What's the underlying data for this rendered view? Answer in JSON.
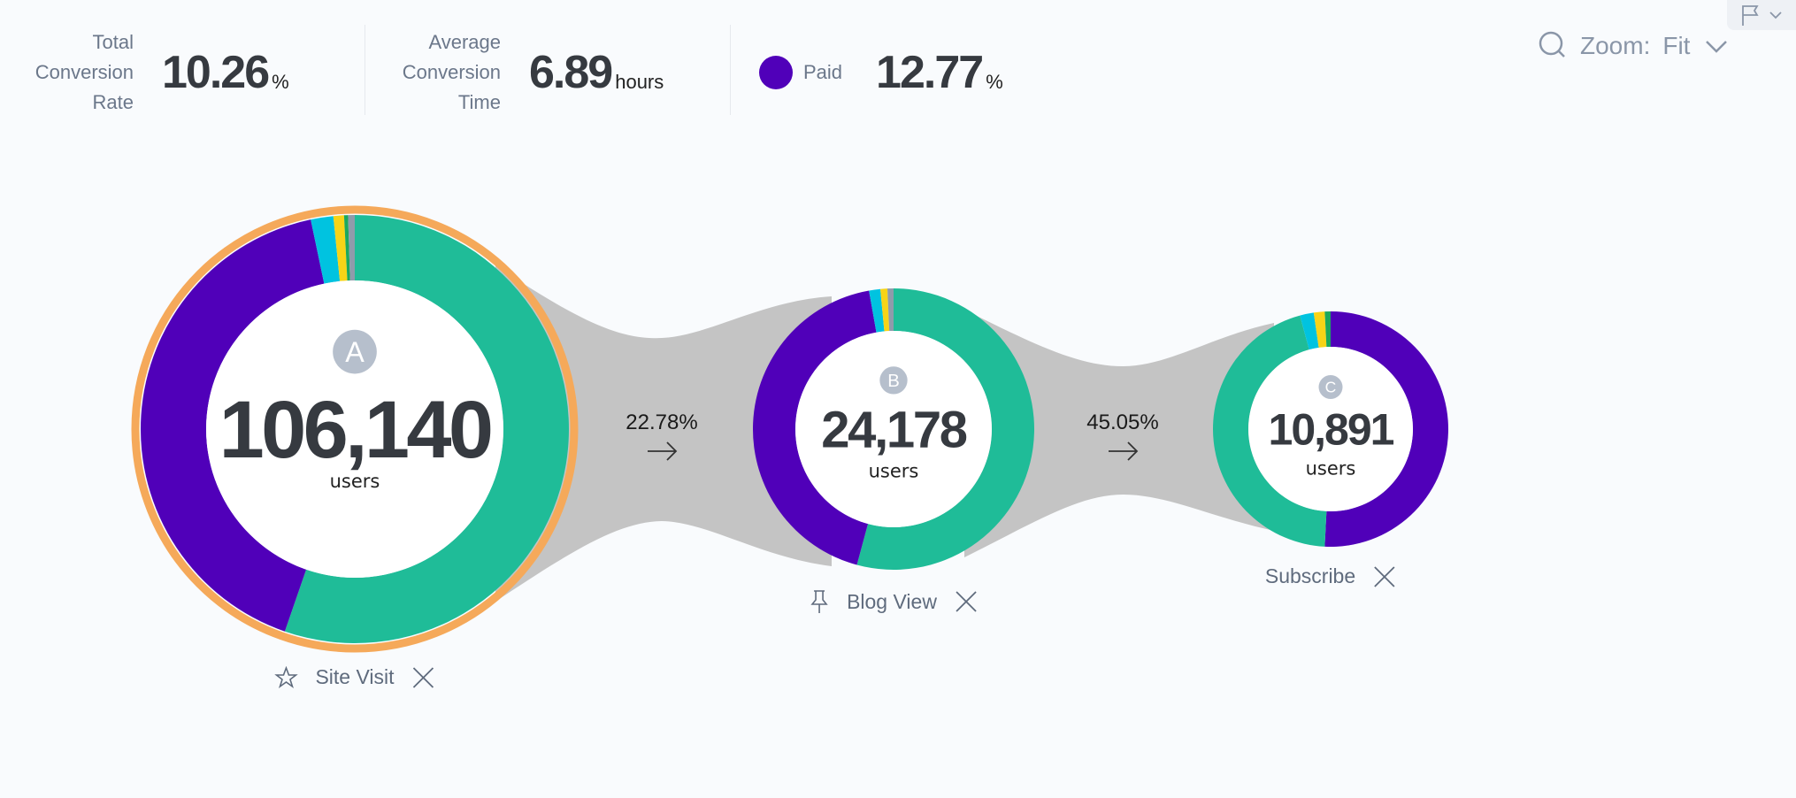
{
  "metrics": {
    "total_conversion": {
      "label_lines": [
        "Total",
        "Conversion",
        "Rate"
      ],
      "value": "10.26",
      "unit": "%"
    },
    "avg_conversion_time": {
      "label_lines": [
        "Average",
        "Conversion",
        "Time"
      ],
      "value": "6.89",
      "unit": "hours"
    },
    "segment": {
      "label": "Paid",
      "value": "12.77",
      "unit": "%",
      "color": "#5000b9"
    }
  },
  "zoom": {
    "label": "Zoom:",
    "value": "Fit",
    "icon": "magnifier-icon"
  },
  "flag_menu": {
    "icon": "flag-icon"
  },
  "colors": {
    "teal": "#1fbc98",
    "purple": "#5000b9",
    "cyan": "#00c3e0",
    "yellow": "#f7d417",
    "green": "#1ba85e",
    "gray": "#8f9bab",
    "selected_ring": "#f5a95a",
    "flow": "#c4c4c4"
  },
  "steps": [
    {
      "letter": "A",
      "count": "106,140",
      "unit": "users",
      "name": "Site Visit",
      "icon": "star-icon",
      "selected": true,
      "segments": [
        {
          "color": "#1fbc98",
          "pct": 55.3
        },
        {
          "color": "#5000b9",
          "pct": 41.4
        },
        {
          "color": "#00c3e0",
          "pct": 1.7
        },
        {
          "color": "#f7d417",
          "pct": 0.8
        },
        {
          "color": "#1ba85e",
          "pct": 0.3
        },
        {
          "color": "#8f9bab",
          "pct": 0.5
        }
      ]
    },
    {
      "letter": "B",
      "count": "24,178",
      "unit": "users",
      "name": "Blog View",
      "icon": "pin-icon",
      "selected": false,
      "segments": [
        {
          "color": "#1fbc98",
          "pct": 54.2
        },
        {
          "color": "#5000b9",
          "pct": 43.0
        },
        {
          "color": "#00c3e0",
          "pct": 1.3
        },
        {
          "color": "#f7d417",
          "pct": 0.8
        },
        {
          "color": "#8f9bab",
          "pct": 0.7
        }
      ]
    },
    {
      "letter": "C",
      "count": "10,891",
      "unit": "users",
      "name": "Subscribe",
      "icon": "",
      "selected": false,
      "segments": [
        {
          "color": "#5000b9",
          "pct": 50.8
        },
        {
          "color": "#1fbc98",
          "pct": 45.0
        },
        {
          "color": "#00c3e0",
          "pct": 1.9
        },
        {
          "color": "#f7d417",
          "pct": 1.5
        },
        {
          "color": "#1ba85e",
          "pct": 0.8
        }
      ]
    }
  ],
  "transitions": [
    {
      "rate": "22.78%"
    },
    {
      "rate": "45.05%"
    }
  ]
}
